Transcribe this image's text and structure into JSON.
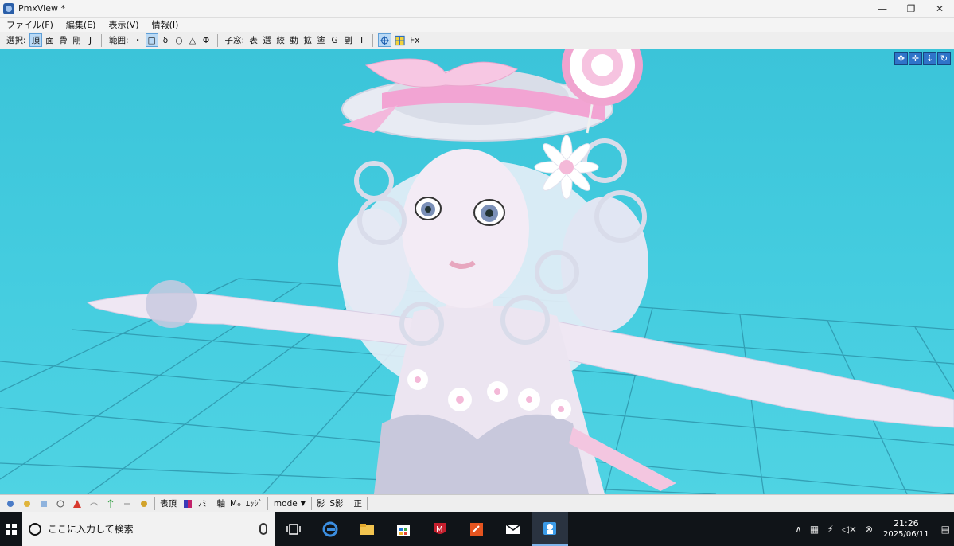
{
  "window": {
    "title": "PmxView *",
    "controls": [
      "—",
      "❐",
      "✕"
    ]
  },
  "menu": [
    "ファイル(F)",
    "編集(E)",
    "表示(V)",
    "情報(I)"
  ],
  "toolbar": {
    "select_label": "選択:",
    "select_buttons": [
      "頂",
      "面",
      "骨",
      "剛",
      "J"
    ],
    "range_label": "範囲:",
    "range_buttons": [
      "・",
      "□",
      "δ",
      "○",
      "△",
      "Φ"
    ],
    "child_label": "子窓:",
    "child_buttons": [
      "表",
      "選",
      "絞",
      "動",
      "拡",
      "塗",
      "G",
      "副",
      "T"
    ],
    "fx_label": "Fx"
  },
  "statusbar": {
    "morph_label": "表頂",
    "no_label": "ﾉﾐ",
    "axis_label": "軸",
    "md_label": "Mℴ",
    "edge_label": "ｴｯｼﾞ",
    "mode_label": "mode",
    "shadow_label": "影",
    "sshadow_label": "S影",
    "correct_label": "正"
  },
  "taskbar": {
    "search_placeholder": "ここに入力して検索",
    "time": "21:26",
    "date": "2025/06/11"
  },
  "colors": {
    "viewport_bg": "#45cde0",
    "grid": "#2a8fa6",
    "active_button": "#b9d9f5",
    "taskbar_bg": "#101418"
  }
}
